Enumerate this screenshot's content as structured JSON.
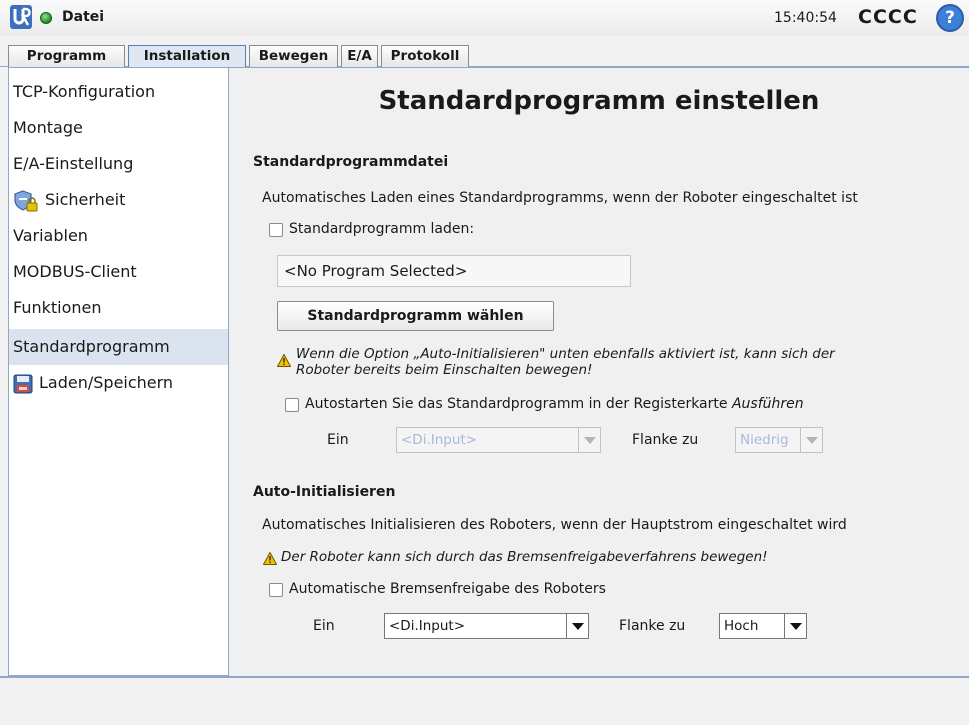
{
  "topbar": {
    "file_label": "Datei",
    "clock": "15:40:54",
    "robot_name": "CCCC",
    "help_label": "?"
  },
  "tabs": [
    {
      "label": "Programm",
      "active": false
    },
    {
      "label": "Installation",
      "active": true
    },
    {
      "label": "Bewegen",
      "active": false
    },
    {
      "label": "E/A",
      "active": false
    },
    {
      "label": "Protokoll",
      "active": false
    }
  ],
  "sidebar": {
    "items": [
      {
        "label": "TCP-Konfiguration"
      },
      {
        "label": "Montage"
      },
      {
        "label": "E/A-Einstellung"
      },
      {
        "label": "Sicherheit",
        "icon": "shield-lock-icon"
      },
      {
        "label": "Variablen"
      },
      {
        "label": "MODBUS-Client"
      },
      {
        "label": "Funktionen"
      },
      {
        "label": "Standardprogramm",
        "selected": true
      },
      {
        "label": "Laden/Speichern",
        "icon": "floppy-disk-icon"
      }
    ]
  },
  "main": {
    "title": "Standardprogramm einstellen",
    "section1": {
      "heading": "Standardprogrammdatei",
      "description": "Automatisches Laden eines Standardprogramms, wenn der Roboter eingeschaltet ist",
      "load_checkbox_label": "Standardprogramm laden:",
      "program_path": "<No Program Selected>",
      "choose_button": "Standardprogramm wählen",
      "warning_line1": "Wenn die Option „Auto-Initialisieren\" unten ebenfalls aktiviert ist, kann sich der",
      "warning_line2": "Roboter bereits beim Einschalten bewegen!",
      "autostart_label": "Autostarten Sie das Standardprogramm in der Registerkarte ",
      "autostart_label_italic": "Ausführen",
      "input_label": "Ein",
      "input_value": "<Di.Input>",
      "edge_label": "Flanke zu",
      "edge_value": "Niedrig"
    },
    "section2": {
      "heading": "Auto-Initialisieren",
      "description": "Automatisches Initialisieren des Roboters, wenn der Hauptstrom eingeschaltet wird",
      "warning": "Der Roboter kann sich durch das Bremsenfreigabeverfahrens bewegen!",
      "brake_checkbox_label": "Automatische Bremsenfreigabe des Roboters",
      "input_label": "Ein",
      "input_value": "<Di.Input>",
      "edge_label": "Flanke zu",
      "edge_value": "Hoch"
    }
  },
  "colors": {
    "accent": "#8fa8c8",
    "selected_bg": "#dbe3ef",
    "status_green": "#1f8a1f",
    "warning_yellow": "#f2c200",
    "help_blue": "#3c7fd9"
  }
}
